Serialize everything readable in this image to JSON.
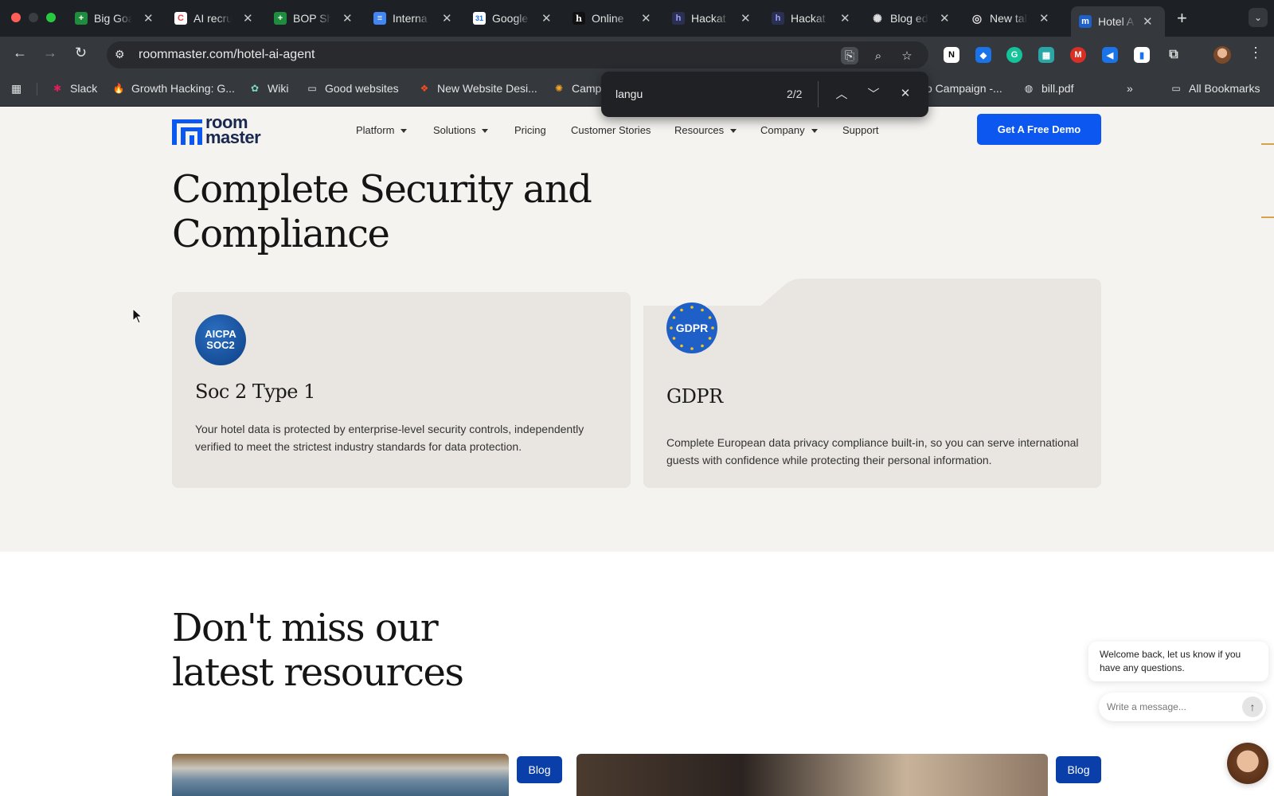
{
  "browser": {
    "tabs": [
      {
        "title": "Big Goa",
        "icon": "google-sheets-icon",
        "color": "#1e8e3e"
      },
      {
        "title": "AI recru",
        "icon": "clickup-icon",
        "color": "#ffffff"
      },
      {
        "title": "BOP Sh",
        "icon": "google-sheets-icon",
        "color": "#1e8e3e"
      },
      {
        "title": "Interna",
        "icon": "google-docs-icon",
        "color": "#4285f4"
      },
      {
        "title": "Google",
        "icon": "google-calendar-icon",
        "color": "#1a73e8"
      },
      {
        "title": "Online",
        "icon": "hackerrank-icon",
        "color": "#111111"
      },
      {
        "title": "Hackat",
        "icon": "hackathon-icon",
        "color": "#2b2f52"
      },
      {
        "title": "Hackat",
        "icon": "hackathon-icon",
        "color": "#2b2f52"
      },
      {
        "title": "Blog ed",
        "icon": "openai-icon",
        "color": "#1d2024"
      },
      {
        "title": "New tal",
        "icon": "chrome-icon",
        "color": "#1d2024"
      },
      {
        "title": "Hotel A",
        "icon": "roommaster-icon",
        "color": "#1f5fc8"
      }
    ],
    "url": "roommaster.com/hotel-ai-agent",
    "bookmarks": [
      {
        "label": "Slack"
      },
      {
        "label": "Growth Hacking: G..."
      },
      {
        "label": "Wiki"
      },
      {
        "label": "Good websites"
      },
      {
        "label": "New Website Desi..."
      },
      {
        "label": "Camp"
      },
      {
        "label": "o Campaign -..."
      },
      {
        "label": "bill.pdf"
      }
    ],
    "all_bookmarks": "All Bookmarks",
    "find": {
      "query": "langu",
      "count": "2/2"
    }
  },
  "site": {
    "logo_line1": "room",
    "logo_line2": "master",
    "nav": {
      "platform": "Platform",
      "solutions": "Solutions",
      "pricing": "Pricing",
      "customer_stories": "Customer Stories",
      "resources": "Resources",
      "company": "Company",
      "support": "Support"
    },
    "cta": "Get A Free Demo"
  },
  "security": {
    "heading": "Complete Security and Compliance",
    "cards": [
      {
        "badge_line1": "AICPA",
        "badge_line2": "SOC2",
        "title": "Soc 2 Type 1",
        "body": "Your hotel data is protected by enterprise-level security controls, independently verified to meet the strictest industry standards for data protection."
      },
      {
        "badge_line1": "GDPR",
        "title": "GDPR",
        "body": "Complete European data privacy compliance built-in, so you can serve international guests with confidence while protecting their personal information."
      }
    ]
  },
  "resources": {
    "heading": "Don't miss our latest resources",
    "tags": [
      "Blog",
      "Blog"
    ]
  },
  "chat": {
    "welcome": "Welcome back, let us know if you have any questions.",
    "placeholder": "Write a message..."
  },
  "colors": {
    "accent": "#0b57f0",
    "blog_tag": "#0a3ea8",
    "page_bg": "#f4f3f0",
    "card_bg": "#e9e6e1"
  }
}
